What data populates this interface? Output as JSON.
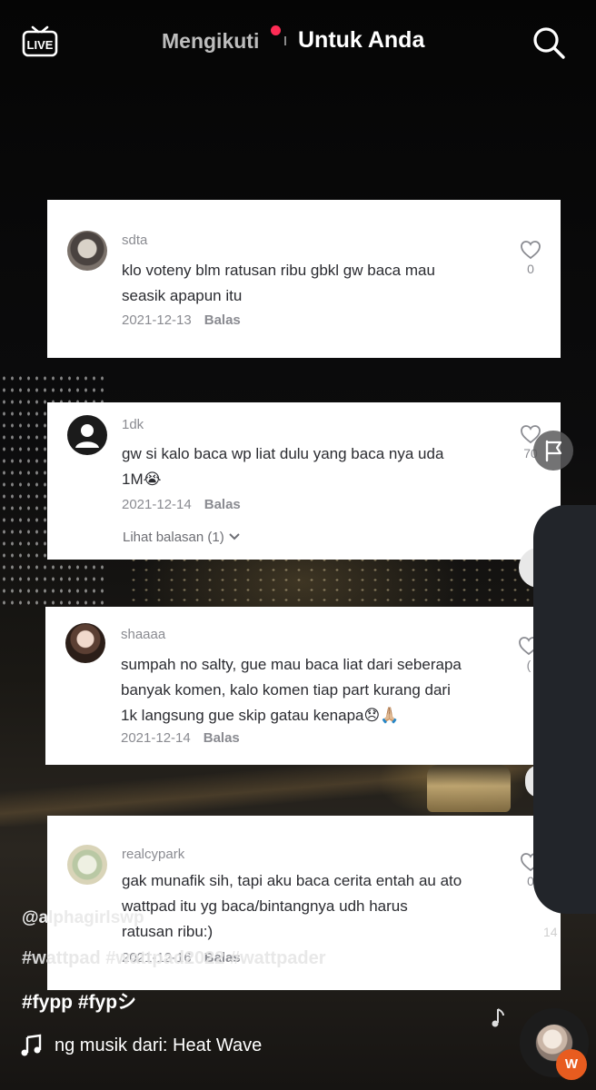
{
  "nav": {
    "live_label": "LIVE",
    "following_label": "Mengikuti",
    "for_you_label": "Untuk Anda"
  },
  "comments": [
    {
      "username": "sdta",
      "text_lines": [
        "klo voteny blm ratusan ribu gbkl gw baca mau",
        "seasik apapun itu"
      ],
      "date": "2021-12-13",
      "reply_label": "Balas",
      "likes": "0"
    },
    {
      "username": "1dk",
      "text_lines": [
        "gw si kalo baca wp liat dulu yang baca nya uda",
        "1M😭"
      ],
      "date": "2021-12-14",
      "reply_label": "Balas",
      "likes": "70",
      "view_replies": "Lihat balasan (1)"
    },
    {
      "username": "shaaaa",
      "text_lines": [
        "sumpah no salty, gue mau baca liat dari seberapa",
        "banyak komen, kalo komen tiap part kurang dari",
        "1k langsung gue skip gatau kenapa😞🙏🏼"
      ],
      "date": "2021-12-14",
      "reply_label": "Balas",
      "likes": "("
    },
    {
      "username": "realcypark",
      "text_lines": [
        "gak munafik sih, tapi aku baca cerita entah au ato",
        "wattpad itu yg baca/bintangnya udh harus",
        "ratusan ribu:)"
      ],
      "date": "2021-12-16",
      "reply_label": "Balas",
      "likes": "0"
    }
  ],
  "side": {
    "count": "14"
  },
  "video": {
    "author": "@alphagirlswp",
    "tags_line1": "#wattpad #wattpad2022 #wattpader",
    "tags_line2": "#fypp #fypシ",
    "music_text": "ng musik dari: Heat Wave",
    "badge_label": "W"
  }
}
